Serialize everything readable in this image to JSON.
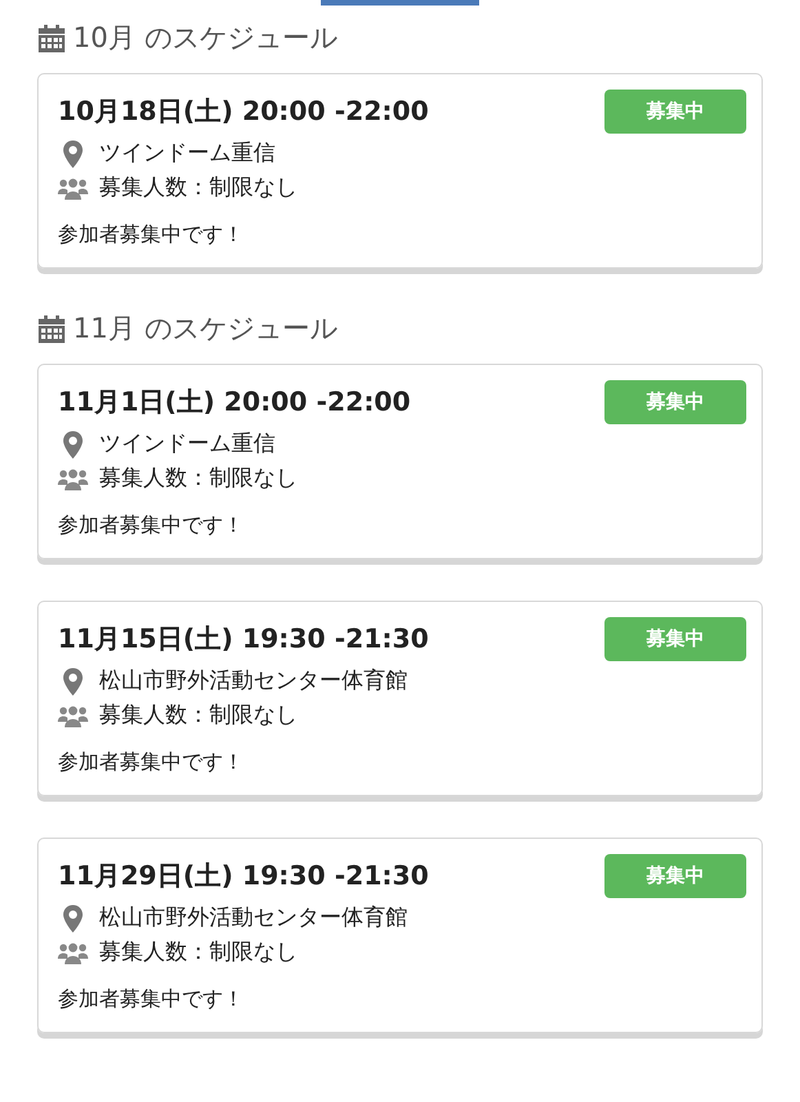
{
  "sections": [
    {
      "heading": "10月 のスケジュール",
      "events": [
        {
          "datetime": "10月18日(土) 20:00 -22:00",
          "status": {
            "label": "募集中",
            "kind": "open"
          },
          "venue": "ツインドーム重信",
          "capacity": "募集人数：制限なし",
          "message": "参加者募集中です！"
        }
      ]
    },
    {
      "heading": "11月 のスケジュール",
      "events": [
        {
          "datetime": "11月1日(土) 20:00 -22:00",
          "status": {
            "label": "募集中",
            "kind": "open"
          },
          "venue": "ツインドーム重信",
          "capacity": "募集人数：制限なし",
          "message": "参加者募集中です！"
        },
        {
          "datetime": "11月15日(土) 19:30 -21:30",
          "status": {
            "label": "募集中",
            "kind": "open"
          },
          "venue": "松山市野外活動センター体育館",
          "capacity": "募集人数：制限なし",
          "message": "参加者募集中です！"
        },
        {
          "datetime": "11月29日(土) 19:30 -21:30",
          "status": {
            "label": "募集中",
            "kind": "open"
          },
          "venue": "松山市野外活動センター体育館",
          "capacity": "募集人数：制限なし",
          "message": "参加者募集中です！"
        }
      ]
    }
  ]
}
